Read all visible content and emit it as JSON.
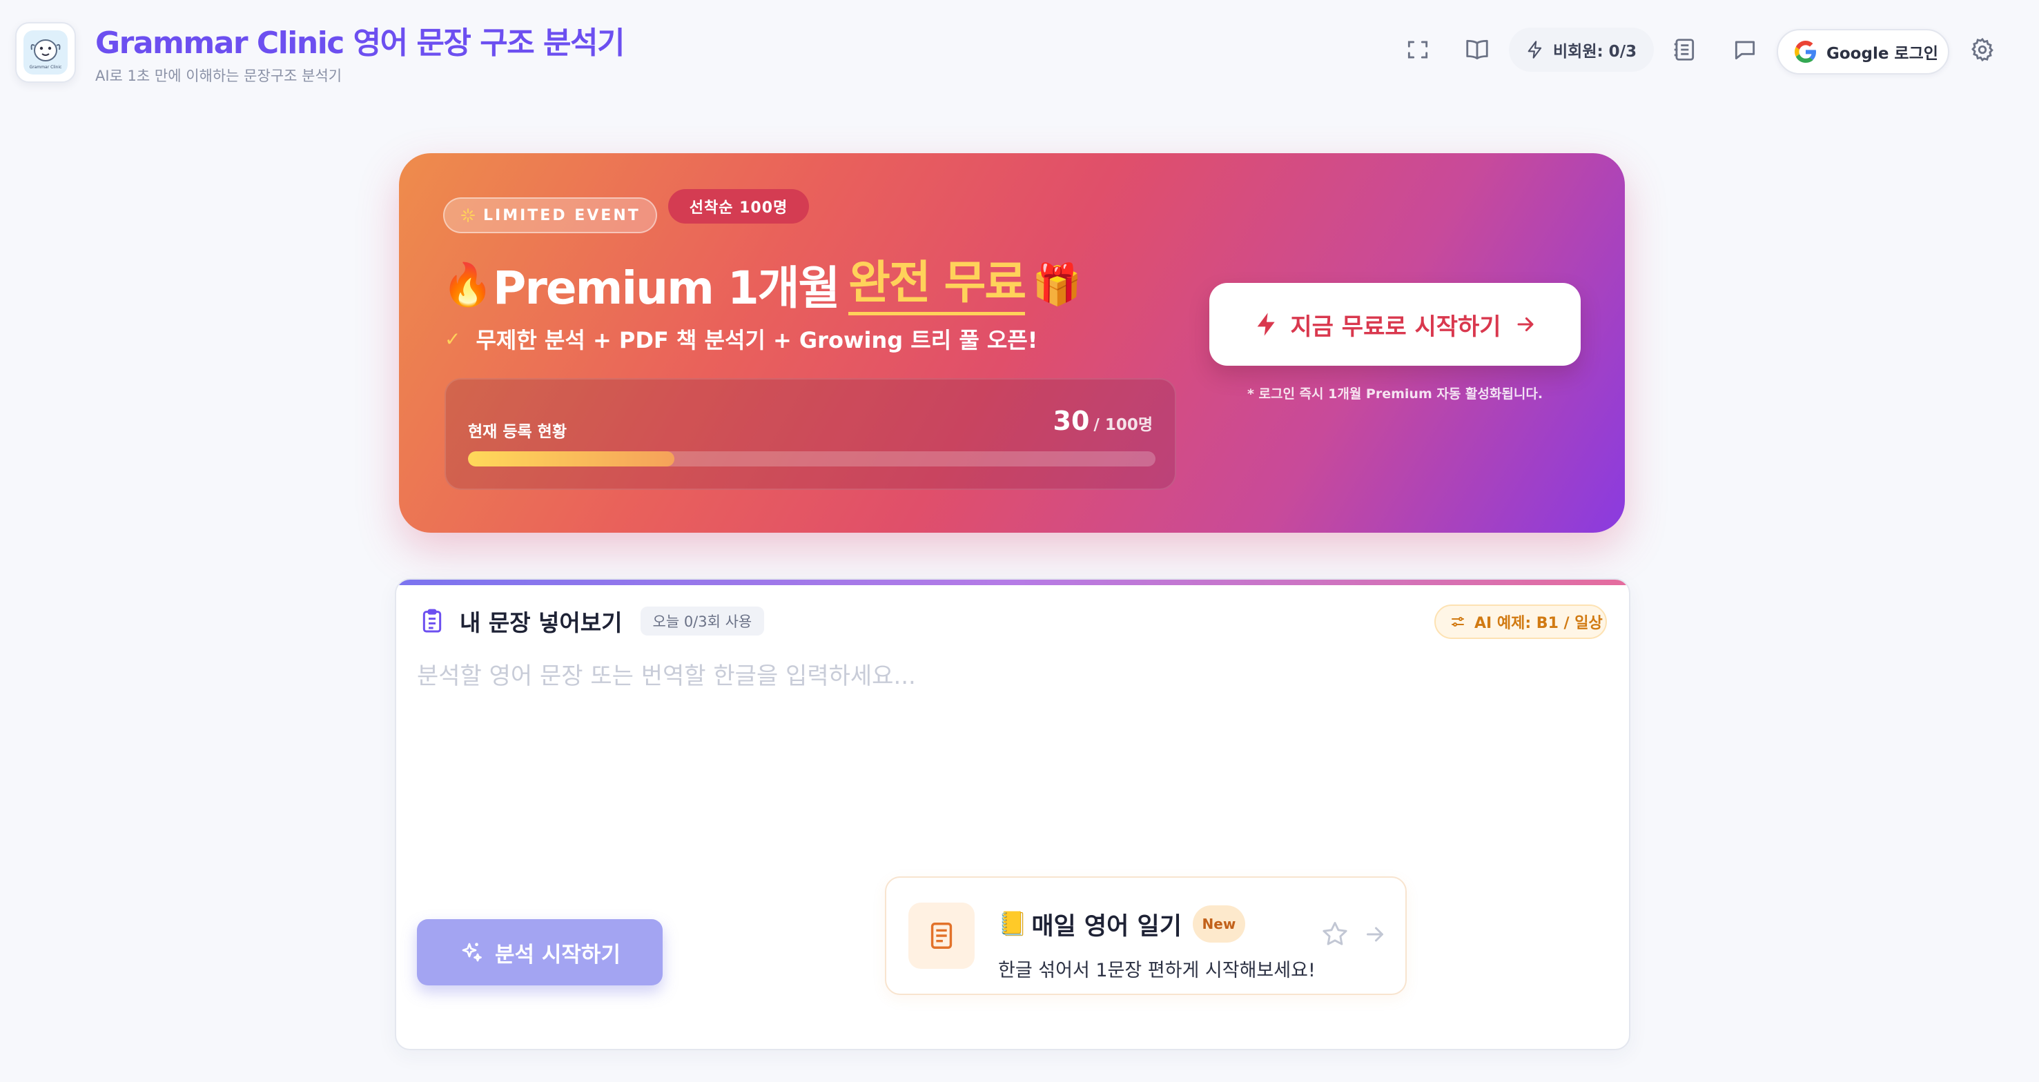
{
  "header": {
    "app_title": "Grammar Clinic 영어 문장 구조 분석기",
    "app_subtitle": "AI로 1초 만에 이해하는 문장구조 분석기",
    "logo_text": "Grammar Clinic",
    "guest_usage": "비회원: 0/3",
    "google_login_label": "Google 로그인",
    "icons": [
      "fullscreen-icon",
      "book-open-icon",
      "bolt-icon",
      "notebook-icon",
      "chat-icon",
      "google-icon",
      "settings-icon"
    ]
  },
  "promo": {
    "event_badge": "LIMITED EVENT",
    "first_come_badge": "선착순 100명",
    "title_emoji": "🔥",
    "title_main": "Premium 1개월",
    "title_highlight": "완전 무료",
    "title_emoji_end": "🎁",
    "features": "무제한 분석 + PDF 책 분석기 + Growing 트리 풀 오픈!",
    "progress_label": "현재 등록 현황",
    "registered_count": "30",
    "registered_total": "/ 100명",
    "progress_fraction": 0.3,
    "cta_label": "지금 무료로 시작하기",
    "cta_note": "* 로그인 즉시 1개월 Premium 자동 활성화됩니다.",
    "colors": {
      "highlight": "#ffd25a",
      "cta_text": "#d9384e"
    }
  },
  "input_card": {
    "title": "내 문장 넣어보기",
    "usage": "오늘 0/3회 사용",
    "ai_example": "AI 예제: B1 / 일상",
    "input_value": "",
    "input_placeholder": "분석할 영어 문장 또는 번역할 한글을 입력하세요...",
    "analyze_label": "분석 시작하기",
    "diary": {
      "emoji": "📒",
      "title": "매일 영어 일기",
      "badge": "New",
      "description": "한글 섞어서 1문장 편하게 시작해보세요!"
    },
    "colors": {
      "accent": "#6c4ff0",
      "analyze_button": "#a3a4f2"
    }
  }
}
